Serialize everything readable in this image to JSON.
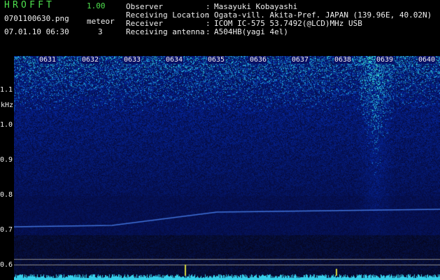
{
  "app": {
    "title": "HROFFT",
    "version": "1.00",
    "file_name": "0701100630.png",
    "meteor_label": "meteor",
    "datetime": "07.01.10 06:30",
    "meteor_count": "3"
  },
  "info": [
    {
      "label": "Observer",
      "value": "Masayuki Kobayashi"
    },
    {
      "label": "Receiving Location",
      "value": "Ogata-vill. Akita-Pref. JAPAN (139.96E, 40.02N)"
    },
    {
      "label": "Receiver",
      "value": "ICOM IC-575 53.7492(@LCD)MHz USB"
    },
    {
      "label": "Receiving antenna",
      "value": "A504HB(yagi 4el)"
    }
  ],
  "info_separator": ":",
  "y_axis": {
    "unit": "kHz",
    "ticks": [
      "1.1",
      "1.0",
      "0.9",
      "0.8",
      "0.7",
      "0.6"
    ]
  },
  "x_axis": {
    "ticks": [
      "0631",
      "0632",
      "0633",
      "0634",
      "0635",
      "0636",
      "0637",
      "0638",
      "0639",
      "0640"
    ]
  },
  "colors": {
    "background": "#000000",
    "label_green": "#4ee04e",
    "spectrogram_low": "#081066",
    "spectrogram_high": "#3cf0ff"
  }
}
